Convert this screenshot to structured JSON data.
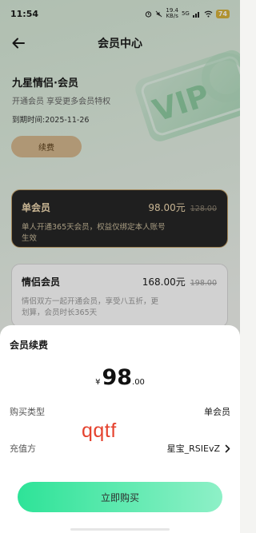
{
  "status_bar": {
    "time": "11:54",
    "speed_top": "19.4",
    "speed_bottom": "KB/s",
    "signal_label": "5G",
    "battery": "74"
  },
  "nav": {
    "title": "会员中心"
  },
  "hero": {
    "title": "九星情侣·会员",
    "subtitle": "开通会员 享受更多会员特权",
    "expire": "到期时间:2025-11-26",
    "renew_label": "续费",
    "vip_art_text": "VIP"
  },
  "plans": [
    {
      "name": "单会员",
      "price": "98.00元",
      "original_price": "128.00",
      "desc": "单人开通365天会员，权益仅绑定本人账号生效",
      "selected": true
    },
    {
      "name": "情侣会员",
      "price": "168.00元",
      "original_price": "198.00",
      "desc": "情侣双方一起开通会员，享受八五折，更划算，会员时长365天",
      "selected": false
    }
  ],
  "sheet": {
    "title": "会员续费",
    "currency": "¥",
    "amount_int": "98",
    "amount_dec": ".00",
    "type_label": "购买类型",
    "type_value": "单会员",
    "account_label": "充值方",
    "account_value": "星宝_RSIEvZ",
    "watermark": "qqtf",
    "buy_label": "立即购买"
  },
  "colors": {
    "accent_green": "#2ee398",
    "gold": "#c6a36a",
    "dark_card": "#262626"
  }
}
